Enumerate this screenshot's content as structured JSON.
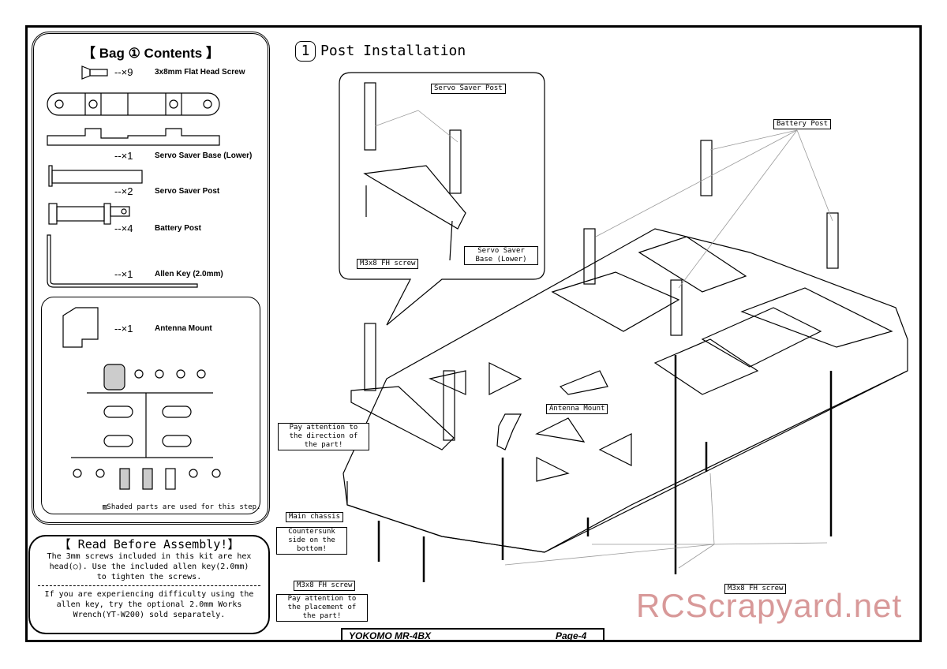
{
  "bag": {
    "title": "【 Bag ① Contents 】",
    "items": [
      {
        "qty": "--×9",
        "name": "3x8mm Flat Head Screw"
      },
      {
        "qty": "--×1",
        "name": "Servo Saver Base (Lower)"
      },
      {
        "qty": "--×2",
        "name": "Servo Saver Post"
      },
      {
        "qty": "--×4",
        "name": "Battery Post"
      },
      {
        "qty": "--×1",
        "name": "Allen Key (2.0mm)"
      },
      {
        "qty": "--×1",
        "name": "Antenna Mount"
      }
    ],
    "shaded_note": "▨Shaded parts are used for this step."
  },
  "read_before": {
    "title": "【 Read Before Assembly!】",
    "p1": "The 3mm screws included in this kit are hex head(○). Use the included allen key(2.0mm) to tighten the screws.",
    "p2": "If you are experiencing difficulty using the allen key, try the optional 2.0mm Works Wrench(YT-W200) sold separately."
  },
  "step": {
    "number": "1",
    "title": "Post Installation"
  },
  "labels": {
    "servo_saver_post": "Servo Saver Post",
    "servo_saver_base": "Servo Saver Base (Lower)",
    "m3x8_inset": "M3x8 FH screw",
    "battery_post": "Battery Post",
    "antenna_mount": "Antenna Mount",
    "pay_attention_direction": "Pay attention to the direction of the part!",
    "main_chassis": "Main chassis",
    "countersunk": "Countersunk side on the bottom!",
    "m3x8_left": "M3x8 FH screw",
    "pay_attention_placement": "Pay attention to the placement of the part!",
    "m3x8_right": "M3x8 FH screw"
  },
  "footer": {
    "model": "YOKOMO MR-4BX",
    "page": "Page-4"
  },
  "watermark": "RCScrapyard.net"
}
